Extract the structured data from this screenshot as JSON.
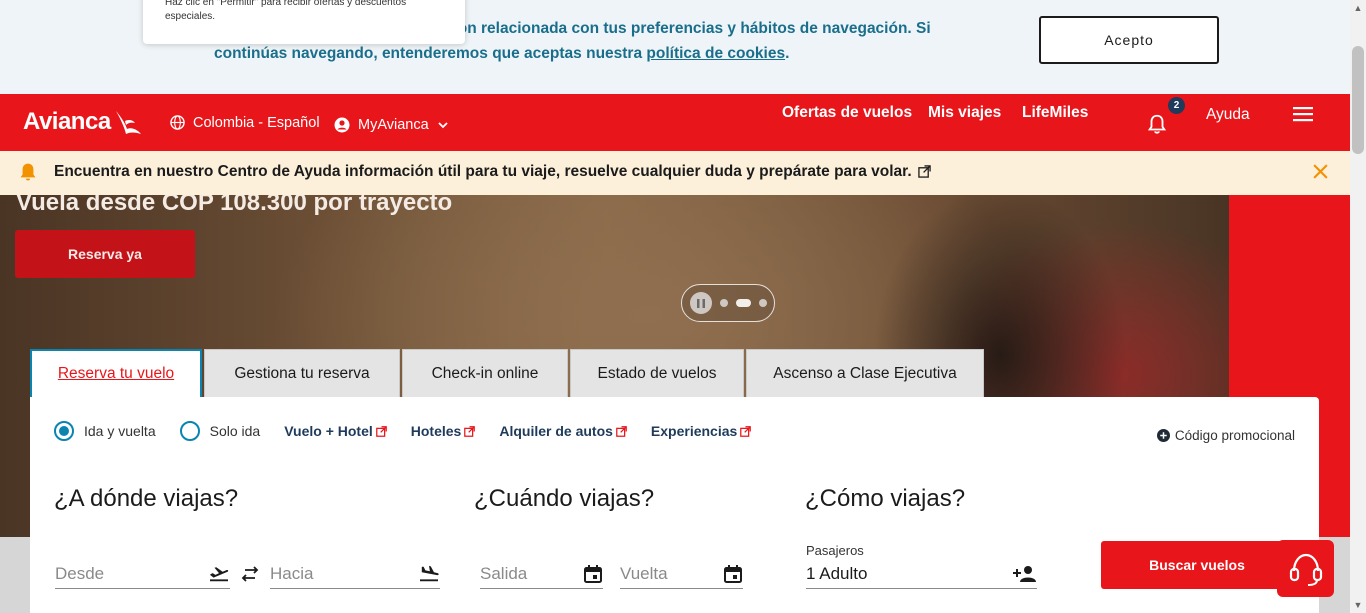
{
  "cookie": {
    "popup_line1": "Haz clic en \"Permitir\" para recibir ofertas y descuentos",
    "popup_line2": "especiales.",
    "text_before": "experiencia y brindarte información relacionada con tus preferencias y hábitos de navegación. Si continúas navegando, entenderemos que aceptas nuestra ",
    "link": "política de cookies",
    "text_after": ".",
    "accept_label": "Acepto"
  },
  "header": {
    "logo": "Avianca",
    "locale": "Colombia - Español",
    "account": "MyAvianca",
    "nav": [
      "Ofertas de vuelos",
      "Mis viajes",
      "LifeMiles"
    ],
    "notifications_count": "2",
    "help": "Ayuda"
  },
  "infobar": {
    "text": "Encuentra en nuestro Centro de Ayuda información útil para tu viaje, resuelve cualquier duda y prepárate para volar."
  },
  "hero": {
    "title": "Vuela desde COP 108.300 por trayecto",
    "cta": "Reserva ya"
  },
  "tabs": [
    "Reserva tu vuelo",
    "Gestiona tu reserva",
    "Check-in online",
    "Estado de vuelos",
    "Ascenso a Clase Ejecutiva"
  ],
  "booking": {
    "trip_options": [
      "Ida y vuelta",
      "Solo ida"
    ],
    "links": [
      "Vuelo + Hotel",
      "Hoteles",
      "Alquiler de autos",
      "Experiencias"
    ],
    "promo": "Código promocional",
    "where_title": "¿A dónde viajas?",
    "when_title": "¿Cuándo viajas?",
    "how_title": "¿Cómo viajas?",
    "from_placeholder": "Desde",
    "to_placeholder": "Hacia",
    "departure_placeholder": "Salida",
    "return_placeholder": "Vuelta",
    "passengers_label": "Pasajeros",
    "passengers_value": "1 Adulto",
    "search_button": "Buscar vuelos"
  },
  "colors": {
    "brand_red": "#e8161b",
    "link_blue": "#1a6e8c",
    "accent_teal": "#0b84b0",
    "dark_navy": "#1f3a5a"
  }
}
